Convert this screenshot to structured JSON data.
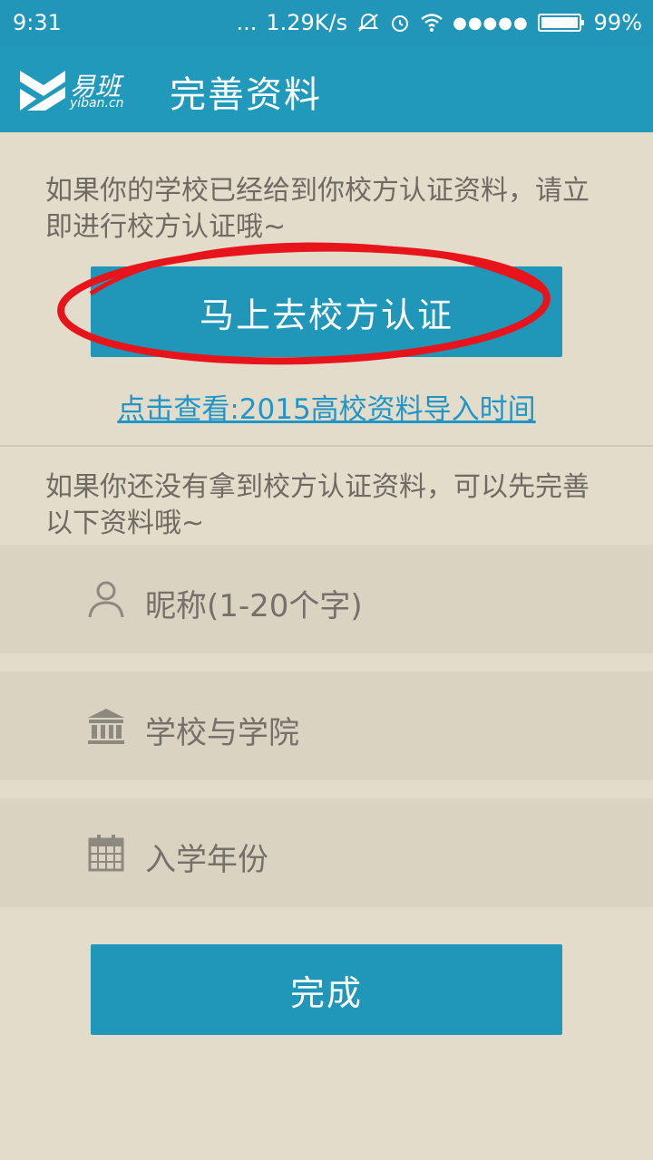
{
  "status_bar": {
    "time": "9:31",
    "dots": "...",
    "speed": "1.29K/s",
    "signal_dots": "●●●●●",
    "battery": "99%",
    "icons": [
      "mute-icon",
      "alarm-icon",
      "wifi-icon",
      "battery-icon"
    ]
  },
  "header": {
    "logo_name": "易班",
    "logo_domain": "yiban.cn",
    "title": "完善资料"
  },
  "main": {
    "intro_text": "如果你的学校已经给到你校方认证资料，请立即进行校方认证哦~",
    "verify_button_label": "马上去校方认证",
    "import_link": "点击查看:2015高校资料导入时间",
    "secondary_text": "如果你还没有拿到校方认证资料，可以先完善以下资料哦~"
  },
  "form": {
    "nickname_placeholder": "昵称(1-20个字)",
    "school_placeholder": "学校与学院",
    "year_placeholder": "入学年份",
    "submit_label": "完成"
  },
  "colors": {
    "accent": "#2097b9",
    "background": "#e3dcca",
    "field_background": "#dad3c2",
    "link": "#2196c6",
    "annotation": "#e8141c"
  }
}
